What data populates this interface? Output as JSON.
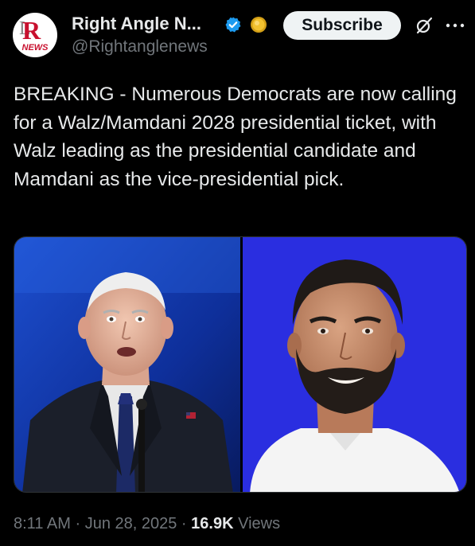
{
  "account": {
    "display_name": "Right Angle N...",
    "handle": "@Rightanglenews",
    "avatar_logo_letter": "R",
    "avatar_logo_text": "NEWS",
    "verified_icon": "verified-badge-icon",
    "coin_icon": "gold-coin-icon"
  },
  "actions": {
    "subscribe_label": "Subscribe",
    "grok_icon": "grok-icon",
    "more_icon": "more-options-icon"
  },
  "tweet": {
    "text": "BREAKING - Numerous Democrats are now calling for a Walz/Mamdani 2028 presidential ticket, with Walz leading as the presidential candidate and Mamdani as the vice-presidential pick."
  },
  "meta": {
    "time": "8:11 AM",
    "separator": "·",
    "date": "Jun 28, 2025",
    "views_count": "16.9K",
    "views_label": "Views"
  },
  "colors": {
    "background": "#000000",
    "text": "#e7e9ea",
    "muted": "#71767b",
    "verified": "#1d9bf0",
    "media_blue": "#2a2ee0"
  }
}
